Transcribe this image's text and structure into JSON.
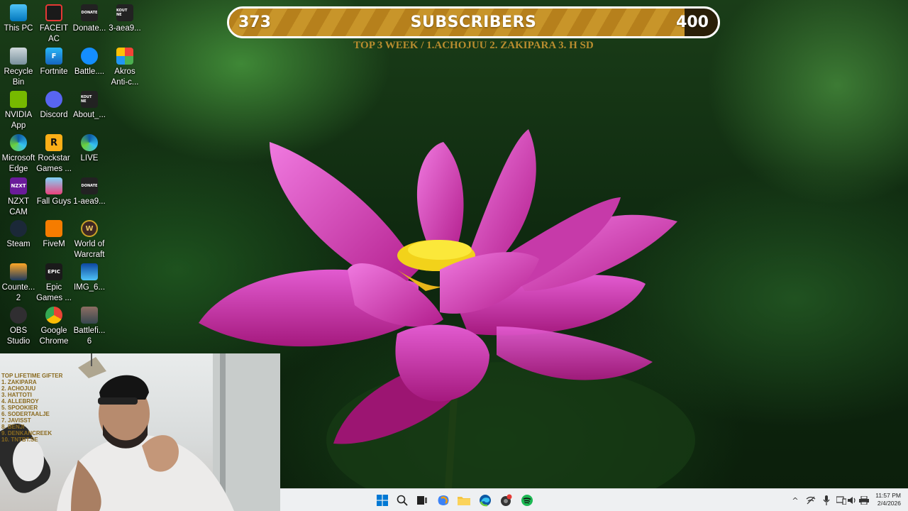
{
  "desktop_icons": [
    {
      "label": "This PC",
      "icon": "this-pc-icon"
    },
    {
      "label": "FACEIT\nAC",
      "icon": "faceit-ac-icon"
    },
    {
      "label": "Donate...",
      "icon": "donate-icon",
      "glyph": "DONATE"
    },
    {
      "label": "3-aea9...",
      "icon": "video-file-icon",
      "glyph": "KOUT NE"
    },
    {
      "label": "Recycle\nBin",
      "icon": "recycle-bin-icon"
    },
    {
      "label": "Fortnite",
      "icon": "fortnite-icon"
    },
    {
      "label": "Battle....",
      "icon": "battlenet-icon"
    },
    {
      "label": "Akros\nAnti-c...",
      "icon": "akros-icon"
    },
    {
      "label": "NVIDIA\nApp",
      "icon": "nvidia-icon"
    },
    {
      "label": "Discord",
      "icon": "discord-icon"
    },
    {
      "label": "About_...",
      "icon": "about-file-icon",
      "glyph": "KOUT NE"
    },
    {
      "label": "Microsoft\nEdge",
      "icon": "edge-icon"
    },
    {
      "label": "Rockstar\nGames ...",
      "icon": "rockstar-icon",
      "glyph": "R"
    },
    {
      "label": "LIVE",
      "icon": "live-icon"
    },
    {
      "label": "NZXT\nCAM",
      "icon": "nzxt-cam-icon",
      "glyph": "NZXT"
    },
    {
      "label": "Fall Guys",
      "icon": "fall-guys-icon"
    },
    {
      "label": "1-aea9...",
      "icon": "video-file-icon",
      "glyph": "DONATE"
    },
    {
      "label": "Steam",
      "icon": "steam-icon"
    },
    {
      "label": "FiveM",
      "icon": "fivem-icon"
    },
    {
      "label": "World of\nWarcraft",
      "icon": "wow-icon",
      "glyph": "W"
    },
    {
      "label": "Counte...\n2",
      "icon": "counter-strike-icon"
    },
    {
      "label": "Epic\nGames ...",
      "icon": "epic-games-icon",
      "glyph": "EPIC"
    },
    {
      "label": "IMG_6...",
      "icon": "image-file-icon"
    },
    {
      "label": "OBS\nStudio",
      "icon": "obs-icon"
    },
    {
      "label": "Google\nChrome",
      "icon": "chrome-icon"
    },
    {
      "label": "Battlefi...\n6",
      "icon": "battlefield-icon"
    }
  ],
  "subscriber_goal": {
    "current": "373",
    "label": "SUBSCRIBERS",
    "goal": "400",
    "progress": 0.9325,
    "top3": "TOP 3 WEEK / 1.ACHOJUU 2. ZAKIPARA 3.  H SD"
  },
  "webcam": {
    "gifter_list": "TOP LIFETIME GIFTER\n1. ZAKIPARA\n2. ACHOJUU\n3. HATTOTI\n4. ALLEBROY\n5. SPOOKIER\n6. SODERTAALJE\n7. JAVISST\n8. BENJI\n9. DENKANCREEK\n10. TNTBT.SE",
    "mic_brand": "shure"
  },
  "taskbar": {
    "apps": [
      "windows-start-icon",
      "search-icon",
      "task-view-icon",
      "copilot-icon",
      "file-explorer-icon",
      "edge-icon",
      "app-red-dot-icon",
      "spotify-icon"
    ],
    "tray": [
      "chevron-up-icon",
      "network-off-icon",
      "microphone-icon",
      "phone-link-icon",
      "volume-icon",
      "printer-icon"
    ],
    "time": "11:57 PM",
    "date": "2/4/2026"
  }
}
